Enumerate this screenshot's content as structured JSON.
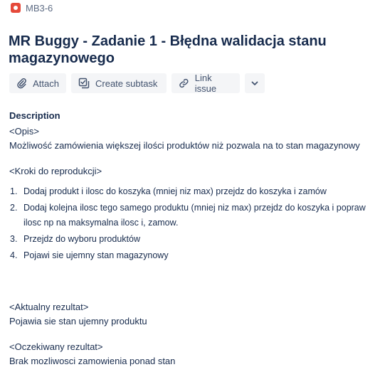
{
  "breadcrumb": {
    "issue_key": "MB3-6",
    "icon": "bug-icon"
  },
  "issue": {
    "title": "MR Buggy - Zadanie 1 - Błędna walidacja stanu magazynowego"
  },
  "toolbar": {
    "attach_label": "Attach",
    "create_subtask_label": "Create subtask",
    "link_issue_label": "Link issue",
    "more_icon": "chevron-down-icon"
  },
  "description": {
    "heading": "Description",
    "opis_tag": "<Opis>",
    "opis_text": "Możliwość zamówienia większej ilości produktów niż pozwala na to stan magazynowy",
    "kroki_tag": "<Kroki do reprodukcji>",
    "steps": [
      {
        "num": "1.",
        "text": "Dodaj produkt i ilosc do koszyka (mniej niz max) przejdz do koszyka  i  zamów"
      },
      {
        "num": "2.",
        "text": "Dodaj kolejna ilosc tego samego produktu (mniej niz max) przejdz do koszyka i popraw ilosc np na maksymalna ilosc i, zamow."
      },
      {
        "num": "3.",
        "text": "Przejdz do wyboru produktów"
      },
      {
        "num": "4.",
        "text": "Pojawi sie ujemny stan magazynowy"
      }
    ],
    "aktualny_tag": "<Aktualny rezultat>",
    "aktualny_text": "Pojawia sie stan ujemny produktu",
    "oczekiwany_tag": "<Oczekiwany rezultat>",
    "oczekiwany_text": "Brak mozliwosci zamowienia ponad stan"
  },
  "colors": {
    "bug": "#e5493a",
    "text": "#172b4d",
    "subtle": "#5e6c84",
    "button_bg": "#f4f5f7"
  }
}
